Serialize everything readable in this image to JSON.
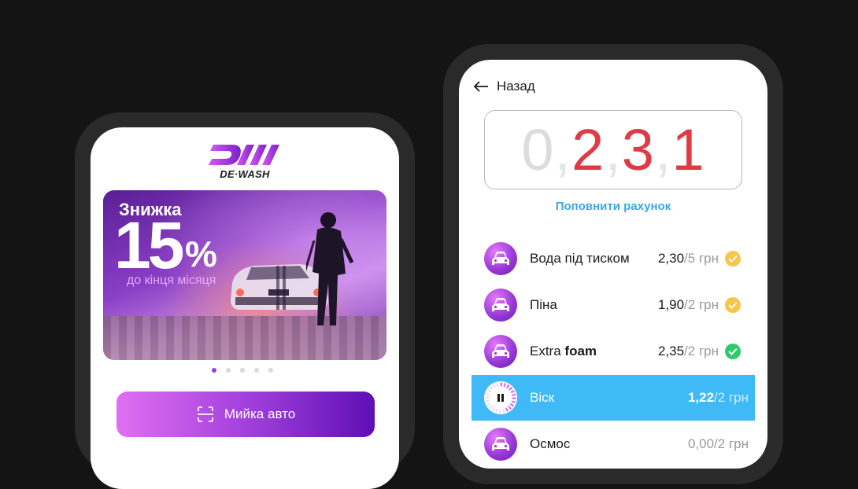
{
  "app": {
    "logo_text": "DE·WASH",
    "logo_icon": "dewash-logo"
  },
  "promo": {
    "title": "Знижка",
    "value": "15",
    "percent_sign": "%",
    "subtitle": "до кінця місяця",
    "slides_count": 5,
    "active_slide": 1
  },
  "wash_button": {
    "label": "Мийка авто",
    "icon": "scan-icon"
  },
  "detail": {
    "back_label": "Назад",
    "balance_digits": [
      "0",
      ",",
      "2",
      ",",
      "3",
      ",",
      "1"
    ],
    "topup_label": "Поповнити рахунок",
    "services": [
      {
        "name": "Вода під тиском",
        "name_bold": "",
        "price": "2,30",
        "unit": "/5 грн",
        "status": "done-yellow"
      },
      {
        "name": "Піна",
        "name_bold": "",
        "price": "1,90",
        "unit": "/2 грн",
        "status": "done-yellow"
      },
      {
        "name": "Extra ",
        "name_bold": "foam",
        "price": "2,35",
        "unit": "/2 грн",
        "status": "done-green"
      },
      {
        "name": "Віск",
        "name_bold": "",
        "price": "1,22",
        "unit": "/2 грн",
        "status": "active"
      },
      {
        "name": "Осмос",
        "name_bold": "",
        "price": "0,00",
        "unit": "/2 грн",
        "status": "pending"
      }
    ]
  },
  "colors": {
    "accent_purple": "#9b3fd6",
    "active_blue": "#3fbaf7",
    "balance_red": "#e03a44",
    "check_yellow": "#f7c548",
    "check_green": "#2ec96b"
  }
}
